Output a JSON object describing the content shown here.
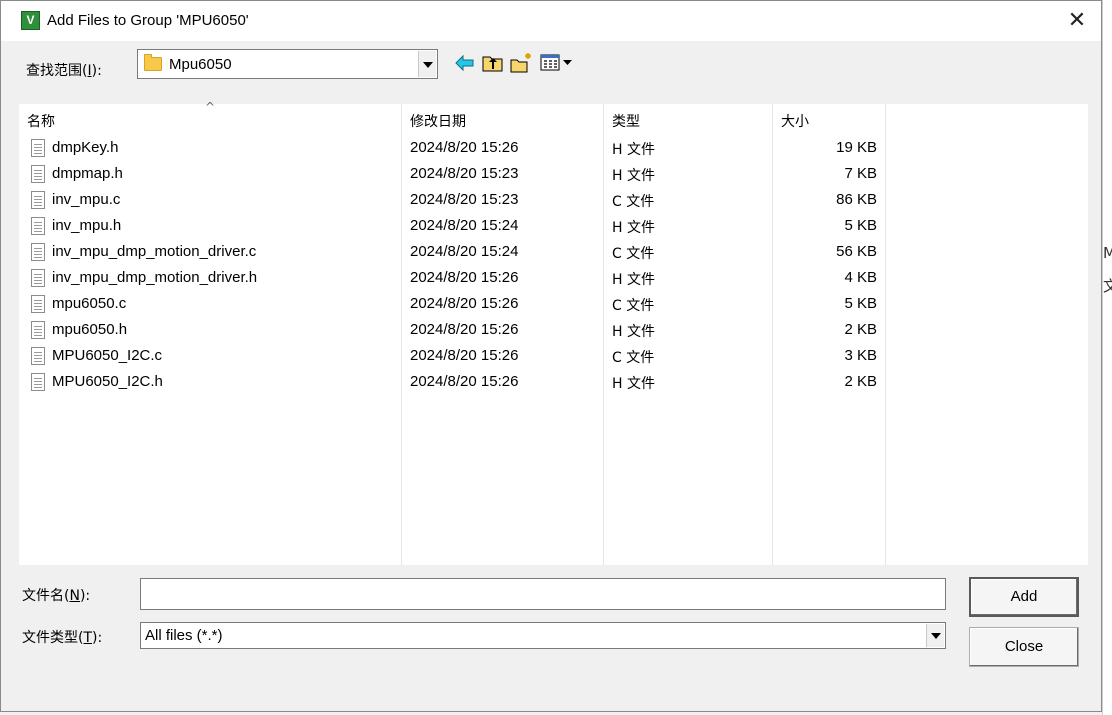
{
  "window": {
    "title": "Add Files to Group 'MPU6050'",
    "icon_letter": "V",
    "close_glyph": "✕"
  },
  "lookin": {
    "label_prefix": "查找范围(",
    "label_key": "I",
    "label_suffix": "):",
    "value": "Mpu6050"
  },
  "columns": {
    "name": "名称",
    "date": "修改日期",
    "type": "类型",
    "size": "大小",
    "sort_caret": "^"
  },
  "files": [
    {
      "name": "dmpKey.h",
      "date": "2024/8/20 15:26",
      "type": "H 文件",
      "size": "19 KB"
    },
    {
      "name": "dmpmap.h",
      "date": "2024/8/20 15:23",
      "type": "H 文件",
      "size": "7 KB"
    },
    {
      "name": "inv_mpu.c",
      "date": "2024/8/20 15:23",
      "type": "C 文件",
      "size": "86 KB"
    },
    {
      "name": "inv_mpu.h",
      "date": "2024/8/20 15:24",
      "type": "H 文件",
      "size": "5 KB"
    },
    {
      "name": "inv_mpu_dmp_motion_driver.c",
      "date": "2024/8/20 15:24",
      "type": "C 文件",
      "size": "56 KB"
    },
    {
      "name": "inv_mpu_dmp_motion_driver.h",
      "date": "2024/8/20 15:26",
      "type": "H 文件",
      "size": "4 KB"
    },
    {
      "name": "mpu6050.c",
      "date": "2024/8/20 15:26",
      "type": "C 文件",
      "size": "5 KB"
    },
    {
      "name": "mpu6050.h",
      "date": "2024/8/20 15:26",
      "type": "H 文件",
      "size": "2 KB"
    },
    {
      "name": "MPU6050_I2C.c",
      "date": "2024/8/20 15:26",
      "type": "C 文件",
      "size": "3 KB"
    },
    {
      "name": "MPU6050_I2C.h",
      "date": "2024/8/20 15:26",
      "type": "H 文件",
      "size": "2 KB"
    }
  ],
  "filename": {
    "label_prefix": "文件名(",
    "label_key": "N",
    "label_suffix": "):",
    "value": ""
  },
  "filetype": {
    "label_prefix": "文件类型(",
    "label_key": "T",
    "label_suffix": "):",
    "value": "All files (*.*)"
  },
  "buttons": {
    "add": "Add",
    "close": "Close"
  },
  "background": {
    "peek_char_1": "M",
    "peek_char_2": "文"
  },
  "icons": {
    "toolbar": [
      "back-arrow-icon",
      "up-folder-icon",
      "new-folder-icon",
      "view-menu-icon"
    ],
    "file": "document-icon",
    "folder": "folder-icon"
  },
  "colors": {
    "dialog_bg": "#f0f0f0",
    "list_bg": "#ffffff",
    "folder_yellow": "#f7c84a",
    "app_icon_green": "#2f8f3a"
  }
}
